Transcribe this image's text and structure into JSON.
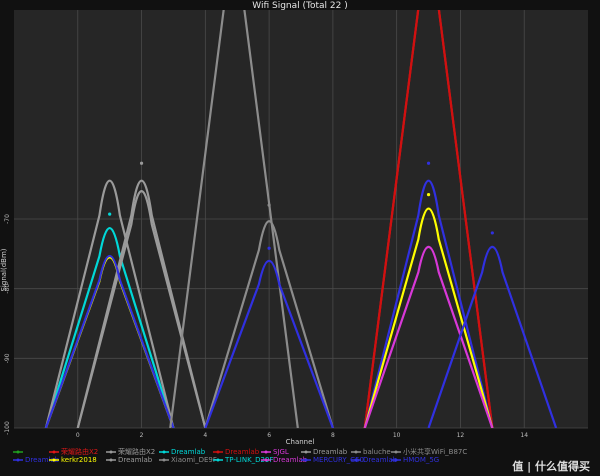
{
  "chart_data": {
    "type": "line",
    "title": "Wifi Signal (Total 22 )",
    "xlabel": "Channel",
    "ylabel": "Signal(dBm)",
    "xlim": [
      -2,
      16
    ],
    "ylim": [
      -100,
      -40
    ],
    "xticks": [
      0,
      2,
      4,
      6,
      8,
      10,
      12,
      14
    ],
    "yticks": [
      -100,
      -90,
      -80,
      -70
    ],
    "grid": true,
    "legend_position": "bottom",
    "series": [
      {
        "name": "Dreamlab",
        "color": "#00d8d8",
        "channel": 1,
        "peak": -71.3,
        "dot": -69.3
      },
      {
        "name": "kerkr2018",
        "color": "#ffff00",
        "channel": 1,
        "peak": -75.5
      },
      {
        "name": "荣耀路由X2",
        "color": "#9a9a9a",
        "channel": 1,
        "peak": -64.5
      },
      {
        "name": "Dreamlab",
        "color": "#9a9a9a",
        "channel": 2,
        "peak": -64.5,
        "dot": -62.0
      },
      {
        "name": "荣耀路由X2",
        "color": "#9a9a9a",
        "channel": 2,
        "peak": -66.0
      },
      {
        "name": "Dreamlab",
        "color": "#3030e0",
        "channel": 1,
        "peak": -75.3
      },
      {
        "name": "baluche",
        "color": "#8c8c8c",
        "channel": 4.9,
        "peak": -30
      },
      {
        "name": "Xiaomi_DE9F",
        "color": "#8c8c8c",
        "channel": 6,
        "peak": -70.3,
        "dot": -68.0
      },
      {
        "name": "Dreamlab",
        "color": "#3030e0",
        "channel": 6,
        "peak": -76.0,
        "dot": -74.2
      },
      {
        "name": "荣耀路由X2",
        "color": "#e01818",
        "channel": 11,
        "peak": -30
      },
      {
        "name": "Dreamlab",
        "color": "#d01010",
        "channel": 11,
        "peak": -30
      },
      {
        "name": "Dreamlab",
        "color": "#3030e0",
        "channel": 11,
        "peak": -64.5,
        "dot": -62.0
      },
      {
        "name": "小米共享WiFi_B87C",
        "color": "#ffff00",
        "channel": 11,
        "peak": -68.5,
        "dot": -66.5
      },
      {
        "name": "SJGL",
        "color": "#d838d8",
        "channel": 11,
        "peak": -74.0
      },
      {
        "name": "TP-LINK_D29F",
        "color": "#3030e0",
        "channel": 13,
        "peak": -74.0,
        "dot": -72.0
      }
    ],
    "legend": [
      {
        "label": "",
        "color": "#20a020"
      },
      {
        "label": "荣耀路由X2",
        "color": "#e01818"
      },
      {
        "label": "荣耀路由X2",
        "color": "#9a9a9a"
      },
      {
        "label": "Dreamlab",
        "color": "#00d8d8"
      },
      {
        "label": "Dreamlab",
        "color": "#d01010"
      },
      {
        "label": "SJGL",
        "color": "#d838d8"
      },
      {
        "label": "Dreamlab",
        "color": "#9a9a9a"
      },
      {
        "label": "baluche",
        "color": "#8c8c8c"
      },
      {
        "label": "小米共享WiFi_B87C",
        "color": "#8c8c8c"
      },
      {
        "label": "Dreamlab",
        "color": "#3030e0"
      },
      {
        "label": "kerkr2018",
        "color": "#ffff00"
      },
      {
        "label": "Dreamlab",
        "color": "#9a9a9a"
      },
      {
        "label": "Xiaomi_DE9F",
        "color": "#8c8c8c"
      },
      {
        "label": "TP-LINK_D29F",
        "color": "#00d8d8"
      },
      {
        "label": "Dreamlab",
        "color": "#d838d8"
      },
      {
        "label": "MERCURY_C50",
        "color": "#3030e0"
      },
      {
        "label": "Dreamlab",
        "color": "#3030e0"
      },
      {
        "label": "HMOM_5G",
        "color": "#3030e0"
      }
    ]
  },
  "watermark": "值 | 什么值得买"
}
